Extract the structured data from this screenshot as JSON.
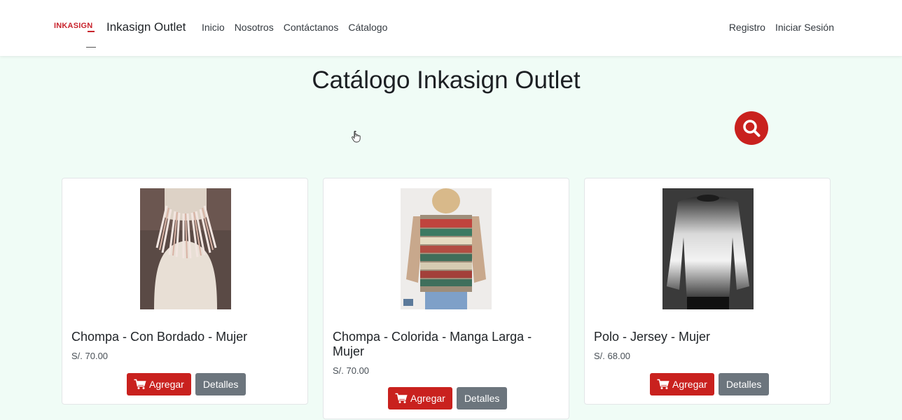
{
  "header": {
    "logo_text": "INKASIGN",
    "brand": "Inkasign Outlet",
    "nav": [
      "Inicio",
      "Nosotros",
      "Contáctanos",
      "Cátalogo"
    ],
    "nav_right": [
      "Registro",
      "Iniciar Sesión"
    ]
  },
  "main": {
    "title": "Catálogo Inkasign Outlet",
    "search_icon": "search-icon"
  },
  "products": [
    {
      "name": "Chompa - Con Bordado - Mujer",
      "price": "S/. 70.00",
      "add_label": "Agregar",
      "details_label": "Detalles"
    },
    {
      "name": "Chompa - Colorida - Manga Larga - Mujer",
      "price": "S/. 70.00",
      "add_label": "Agregar",
      "details_label": "Detalles"
    },
    {
      "name": "Polo - Jersey - Mujer",
      "price": "S/. 68.00",
      "add_label": "Agregar",
      "details_label": "Detalles"
    }
  ],
  "colors": {
    "accent": "#c9211e",
    "secondary": "#6c757d",
    "background": "#f0fcf6"
  }
}
